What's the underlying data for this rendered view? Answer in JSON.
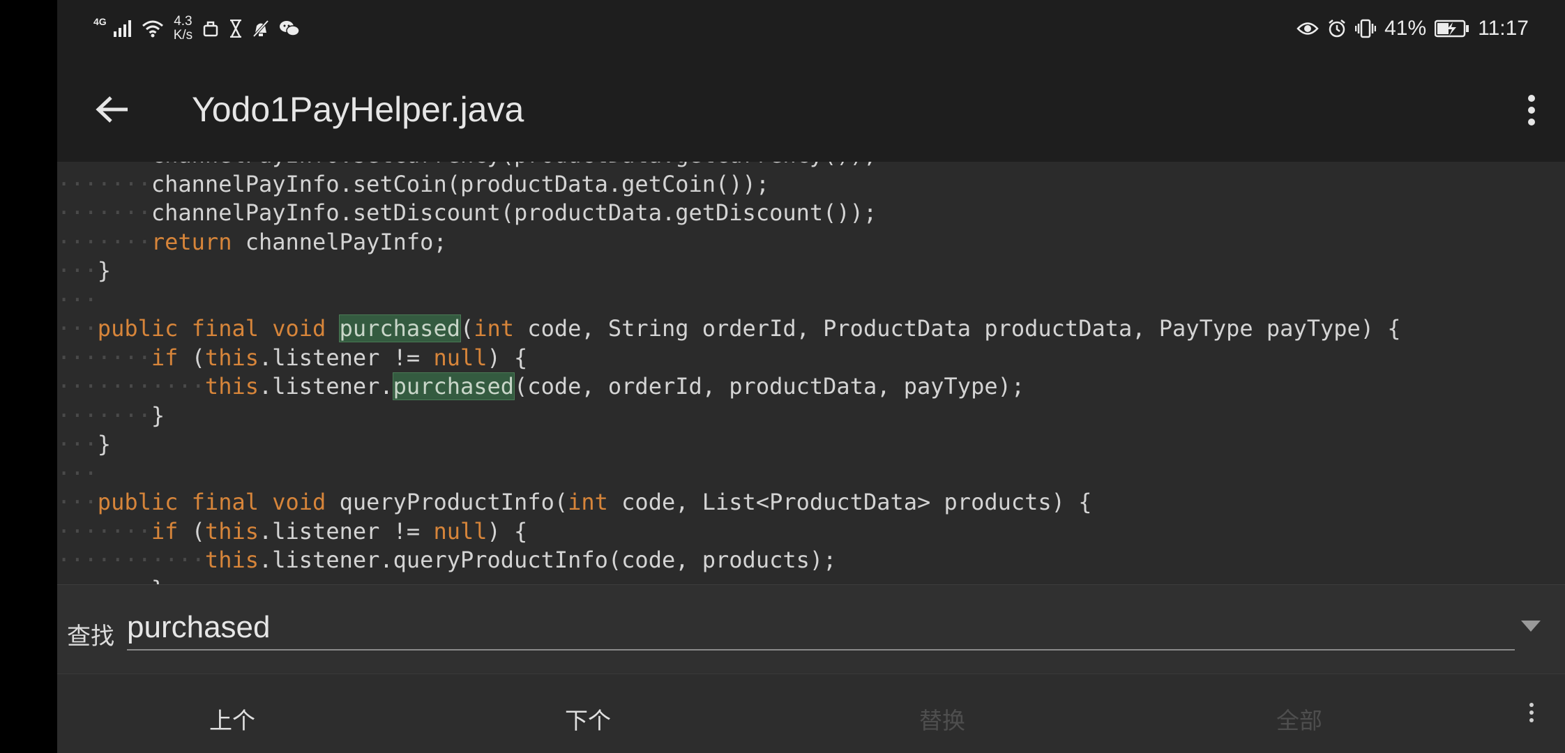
{
  "status_bar": {
    "signal_label": "4G",
    "net_speed_value": "4.3",
    "net_speed_unit": "K/s",
    "battery_percent": "41%",
    "time": "11:17",
    "icons": [
      "signal-icon",
      "wifi-icon",
      "notification-icon",
      "hourglass-icon",
      "mute-icon",
      "wechat-icon",
      "eye-icon",
      "alarm-icon",
      "vibrate-icon",
      "battery-charging-icon"
    ]
  },
  "titlebar": {
    "title": "Yodo1PayHelper.java",
    "back_icon": "arrow-left-icon",
    "menu_icon": "more-vert-icon"
  },
  "code": {
    "lines": [
      {
        "indent": 1,
        "segments": [
          {
            "t": "channelPayInfo.setCurrency(productData.getCurrency());"
          }
        ]
      },
      {
        "indent": 1,
        "segments": [
          {
            "t": "channelPayInfo.setCoin(productData.getCoin());"
          }
        ]
      },
      {
        "indent": 1,
        "segments": [
          {
            "t": "channelPayInfo.setDiscount(productData.getDiscount());"
          }
        ]
      },
      {
        "indent": 1,
        "segments": [
          {
            "t": "return",
            "k": "kw"
          },
          {
            "t": " channelPayInfo;"
          }
        ]
      },
      {
        "indent": 0,
        "segments": [
          {
            "t": "}"
          }
        ]
      },
      {
        "indent": 0,
        "segments": []
      },
      {
        "indent": 0,
        "segments": [
          {
            "t": "public",
            "k": "kw"
          },
          {
            "t": " "
          },
          {
            "t": "final",
            "k": "kw"
          },
          {
            "t": " "
          },
          {
            "t": "void",
            "k": "kw"
          },
          {
            "t": " "
          },
          {
            "t": "purchased",
            "k": "hl"
          },
          {
            "t": "("
          },
          {
            "t": "int",
            "k": "kw"
          },
          {
            "t": " code, String orderId, ProductData productData, PayType payType) {"
          }
        ]
      },
      {
        "indent": 1,
        "segments": [
          {
            "t": "if",
            "k": "kw"
          },
          {
            "t": " ("
          },
          {
            "t": "this",
            "k": "kw"
          },
          {
            "t": ".listener != "
          },
          {
            "t": "null",
            "k": "kw"
          },
          {
            "t": ") {"
          }
        ]
      },
      {
        "indent": 2,
        "segments": [
          {
            "t": "this",
            "k": "kw"
          },
          {
            "t": ".listener."
          },
          {
            "t": "purchased",
            "k": "hl"
          },
          {
            "t": "(code, orderId, productData, payType);"
          }
        ]
      },
      {
        "indent": 1,
        "segments": [
          {
            "t": "}"
          }
        ]
      },
      {
        "indent": 0,
        "segments": [
          {
            "t": "}"
          }
        ]
      },
      {
        "indent": 0,
        "segments": []
      },
      {
        "indent": 0,
        "segments": [
          {
            "t": "public",
            "k": "kw"
          },
          {
            "t": " "
          },
          {
            "t": "final",
            "k": "kw"
          },
          {
            "t": " "
          },
          {
            "t": "void",
            "k": "kw"
          },
          {
            "t": " queryProductInfo("
          },
          {
            "t": "int",
            "k": "kw"
          },
          {
            "t": " code, List<ProductData> products) {"
          }
        ]
      },
      {
        "indent": 1,
        "segments": [
          {
            "t": "if",
            "k": "kw"
          },
          {
            "t": " ("
          },
          {
            "t": "this",
            "k": "kw"
          },
          {
            "t": ".listener != "
          },
          {
            "t": "null",
            "k": "kw"
          },
          {
            "t": ") {"
          }
        ]
      },
      {
        "indent": 2,
        "segments": [
          {
            "t": "this",
            "k": "kw"
          },
          {
            "t": ".listener.queryProductInfo(code, products);"
          }
        ]
      },
      {
        "indent": 1,
        "segments": [
          {
            "t": "}"
          }
        ]
      }
    ]
  },
  "find_bar": {
    "label": "查找",
    "query": "purchased",
    "dropdown_icon": "triangle-down-icon"
  },
  "actions": {
    "prev": "上个",
    "next": "下个",
    "replace": "替换",
    "all": "全部",
    "more_icon": "more-vert-icon"
  },
  "colors": {
    "keyword": "#d7853a",
    "highlight": "#345b40",
    "background": "#2b2b2b",
    "text": "#d4d4d4"
  }
}
